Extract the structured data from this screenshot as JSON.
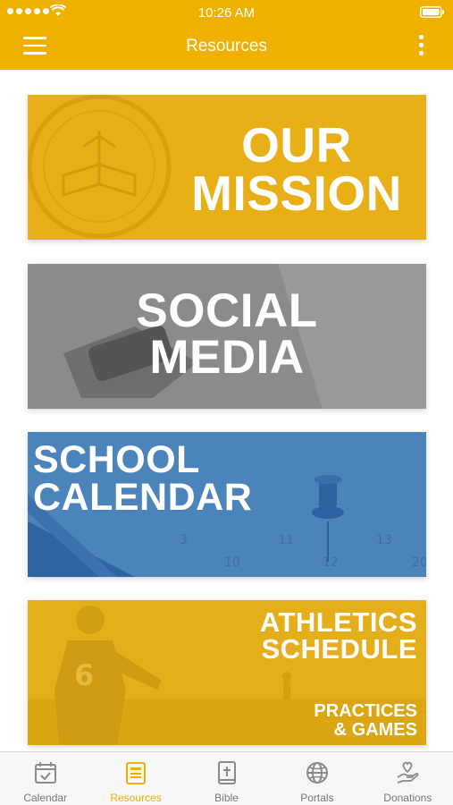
{
  "status_bar": {
    "time": "10:26 AM"
  },
  "header": {
    "title": "Resources"
  },
  "cards": {
    "mission": {
      "line1": "OUR",
      "line2": "MISSION"
    },
    "social": {
      "line1": "SOCIAL",
      "line2": "MEDIA"
    },
    "calendar": {
      "line1": "SCHOOL",
      "line2": "CALENDAR"
    },
    "athletics": {
      "line1": "ATHLETICS",
      "line2": "SCHEDULE",
      "sub1": "PRACTICES",
      "sub2": "& GAMES"
    }
  },
  "tabs": [
    {
      "label": "Calendar",
      "icon": "calendar-icon",
      "active": false
    },
    {
      "label": "Resources",
      "icon": "book-icon",
      "active": true
    },
    {
      "label": "Bible",
      "icon": "bible-icon",
      "active": false
    },
    {
      "label": "Portals",
      "icon": "globe-icon",
      "active": false
    },
    {
      "label": "Donations",
      "icon": "donation-hand-icon",
      "active": false
    }
  ],
  "colors": {
    "accent": "#efb000",
    "mission": "#e9af16",
    "social": "#8c8a8d",
    "calendar": "#4b83bb",
    "athletics": "#e5af1b"
  }
}
